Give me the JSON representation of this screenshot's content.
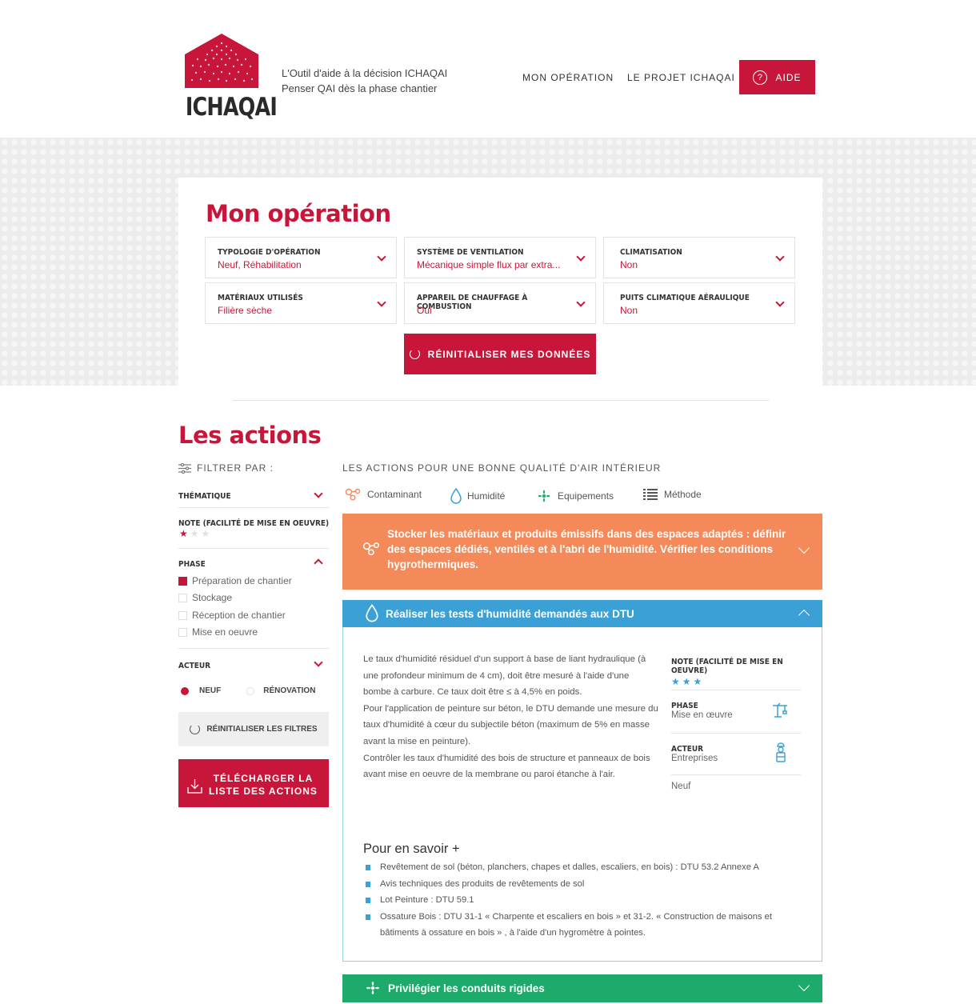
{
  "brand": {
    "logo_text": "ICHAQAI",
    "tagline_line1": "L'Outil d'aide à la décision ICHAQAI",
    "tagline_line2": "Penser QAI dès la phase chantier",
    "color": "#c8163a"
  },
  "nav": {
    "items": [
      "MON OPÉRATION",
      "LE PROJET ICHAQAI"
    ],
    "help_label": "AIDE",
    "help_icon": "question-circle-icon"
  },
  "operation": {
    "title": "Mon opération",
    "fields": [
      {
        "label": "TYPOLOGIE D'OPÉRATION",
        "value": "Neuf, Réhabilitation"
      },
      {
        "label": "SYSTÈME DE VENTILATION",
        "value": "Mécanique simple flux par extra..."
      },
      {
        "label": "CLIMATISATION",
        "value": "Non"
      },
      {
        "label": "MATÉRIAUX UTILISÉS",
        "value": "Filière sèche"
      },
      {
        "label": "APPAREIL DE CHAUFFAGE À COMBUSTION",
        "value": "Oui"
      },
      {
        "label": "PUITS CLIMATIQUE AÉRAULIQUE",
        "value": "Non"
      }
    ],
    "reset_label": "RÉINITIALISER MES DONNÉES"
  },
  "actions": {
    "title": "Les actions",
    "filters": {
      "heading": "FILTRER PAR :",
      "thematique": "THÉMATIQUE",
      "note": "NOTE (FACILITÉ DE MISE EN OEUVRE)",
      "note_value": 1,
      "phase": "PHASE",
      "phase_options": [
        {
          "label": "Préparation de chantier",
          "checked": true
        },
        {
          "label": "Stockage",
          "checked": false
        },
        {
          "label": "Réception de chantier",
          "checked": false
        },
        {
          "label": "Mise en oeuvre",
          "checked": false
        }
      ],
      "acteur": "ACTEUR",
      "radio_neuf": "NEUF",
      "radio_renovation": "RÉNOVATION",
      "reset_filters": "RÉINITIALISER LES FILTRES",
      "download_line1": "TÉLÉCHARGER LA",
      "download_line2": "LISTE DES ACTIONS"
    },
    "list_heading": "LES ACTIONS POUR UNE BONNE QUALITÉ D'AIR INTÉRIEUR",
    "legend": [
      {
        "label": "Contaminant",
        "icon": "contaminant-icon",
        "color": "#f48a5a"
      },
      {
        "label": "Humidité",
        "icon": "droplet-icon",
        "color": "#3aa0d6"
      },
      {
        "label": "Equipements",
        "icon": "fan-icon",
        "color": "#1daa6b"
      },
      {
        "label": "Méthode",
        "icon": "list-icon",
        "color": "#555555"
      }
    ],
    "items": {
      "orange": {
        "text": "Stocker les matériaux et produits émissifs dans des espaces adaptés : définir des espaces dédiés, ventilés et à l'abri de l'humidité. Vérifier les conditions hygrothermiques.",
        "color": "#f48a5a"
      },
      "blue": {
        "title": "Réaliser les tests d'humidité demandés aux DTU",
        "color": "#3aa0d6",
        "body": "Le taux d'humidité résiduel d'un support à base de liant hydraulique (à une profondeur minimum de 4 cm), doit être mesuré à l'aide d'une bombe à carbure. Ce taux doit être ≤ à 4,5% en poids.\nPour l'application de peinture sur béton, le DTU demande une mesure du taux d'humidité à cœur du subjectile béton (maximum de 5% en masse avant la mise en peinture).\nContrôler les taux d'humidité des bois de structure et panneaux de bois avant mise en oeuvre de la membrane ou paroi étanche à l'air.",
        "note_label": "NOTE (FACILITÉ DE MISE EN OEUVRE)",
        "note_value": 3,
        "phase_label": "PHASE",
        "phase_value": "Mise en œuvre",
        "acteur_label": "ACTEUR",
        "acteur_value": "Entreprises",
        "type_value": "Neuf",
        "more_title": "Pour en savoir +",
        "more": [
          "Revêtement de sol (béton, planchers, chapes et dalles, escaliers, en bois) : DTU 53.2 Annexe A",
          "Avis techniques des produits de revêtements de sol",
          "Lot Peinture : DTU 59.1",
          "Ossature Bois : DTU 31-1 « Charpente et escaliers en bois » et 31-2. « Construction de maisons et bâtiments à ossature en bois » , à l'aide d'un hygromètre à pointes."
        ]
      },
      "green": {
        "title": "Privilégier les conduits rigides",
        "color": "#1daa6b"
      }
    }
  }
}
